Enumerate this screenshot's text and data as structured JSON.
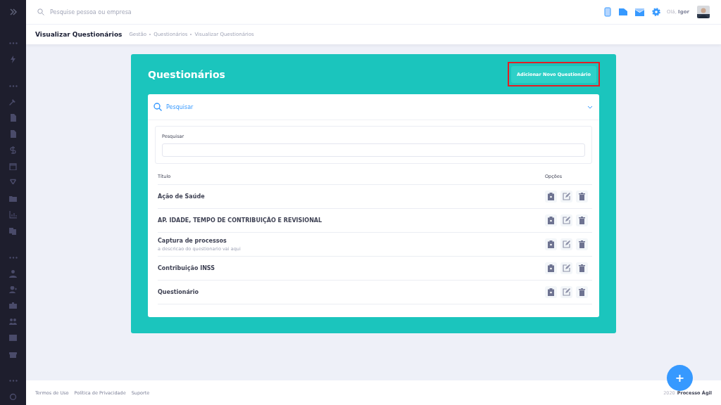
{
  "topbar": {
    "search_placeholder": "Pesquise pessoa ou empresa",
    "greeting": "Olá,",
    "user": "Igor"
  },
  "subheader": {
    "title": "Visualizar Questionários",
    "breadcrumbs": [
      "Gestão",
      "Questionários",
      "Visualizar Questionários"
    ]
  },
  "card": {
    "title": "Questionários",
    "add_button": {
      "label": "Adicionar Novo Questionário",
      "highlighted": true
    },
    "search_panel": {
      "label": "Pesquisar",
      "expanded": true,
      "field_label": "Pesquisar"
    },
    "table": {
      "columns": [
        "Título",
        "Opções"
      ],
      "rows": [
        {
          "title": "Ação de Saúde"
        },
        {
          "title": "AP. IDADE, TEMPO DE CONTRIBUIÇÃO E REVISIONAL"
        },
        {
          "title": "Captura de processos",
          "description": "a descricao do questionario vai aqui"
        },
        {
          "title": "Contribuição INSS"
        },
        {
          "title": "Questionário"
        }
      ]
    }
  },
  "footer": {
    "links": [
      "Termos de Uso",
      "Política de Privacidade",
      "Suporte"
    ],
    "year": "2020",
    "brand": "Processo Ágil"
  },
  "fab": {
    "label": "+"
  }
}
